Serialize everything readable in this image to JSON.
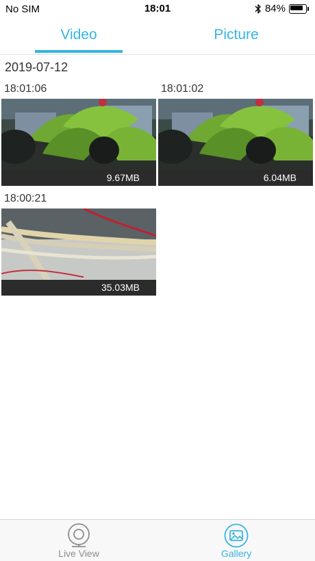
{
  "status_bar": {
    "carrier": "No SIM",
    "time": "18:01",
    "battery_percent": "84%",
    "battery_level": 0.84
  },
  "tabs": [
    {
      "label": "Video",
      "active": true
    },
    {
      "label": "Picture",
      "active": false
    }
  ],
  "accent_color": "#34b4e4",
  "gallery": {
    "date": "2019-07-12",
    "clips": [
      {
        "time": "18:01:06",
        "size": "9.67MB"
      },
      {
        "time": "18:01:02",
        "size": "6.04MB"
      },
      {
        "time": "18:00:21",
        "size": "35.03MB"
      }
    ]
  },
  "bottom_nav": {
    "items": [
      {
        "label": "Live View",
        "icon": "camera-icon",
        "active": false
      },
      {
        "label": "Gallery",
        "icon": "gallery-icon",
        "active": true
      }
    ]
  }
}
